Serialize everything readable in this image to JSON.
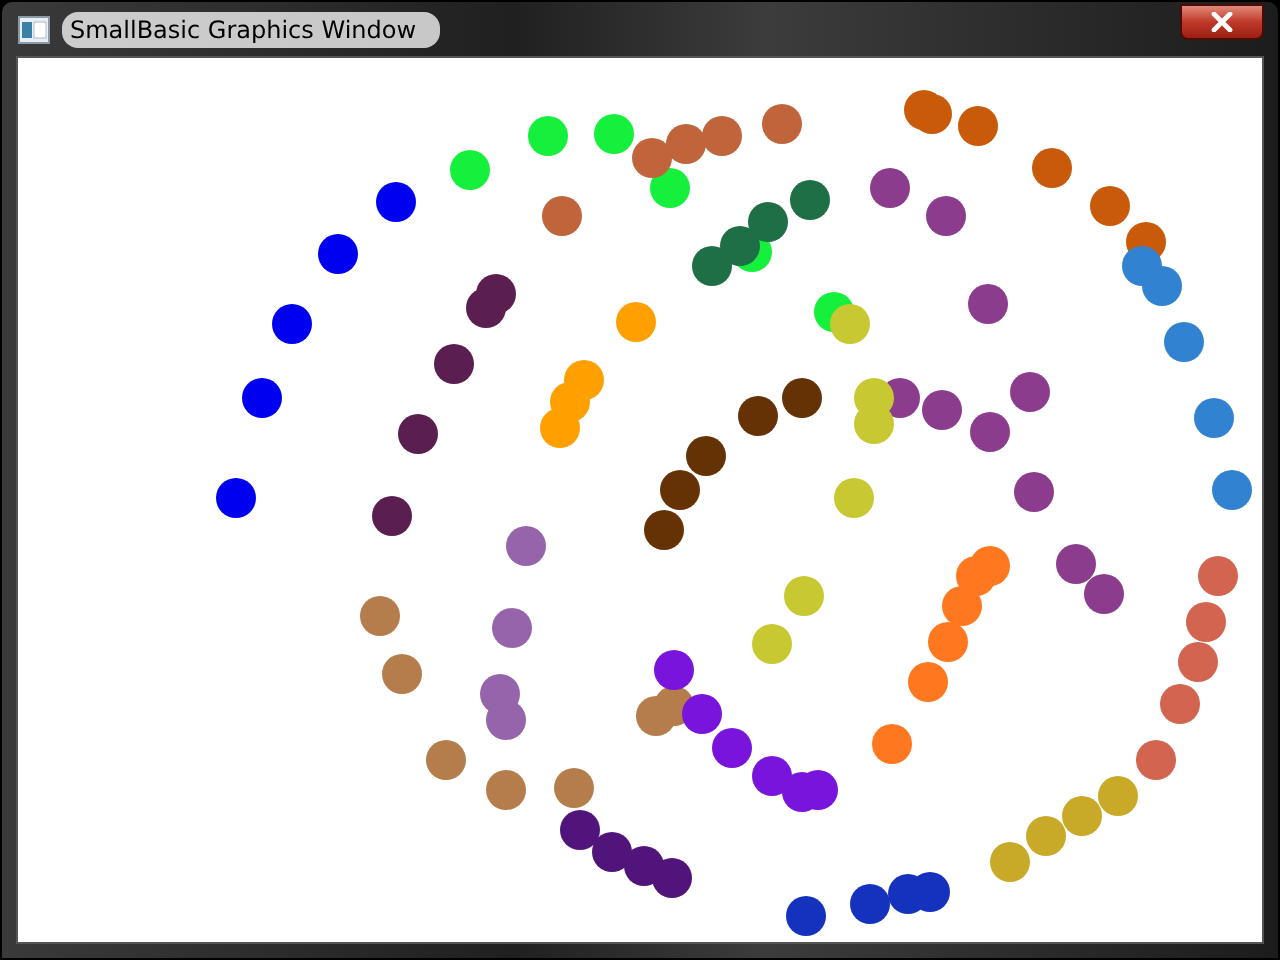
{
  "window": {
    "title": "SmallBasic Graphics Window"
  }
}
